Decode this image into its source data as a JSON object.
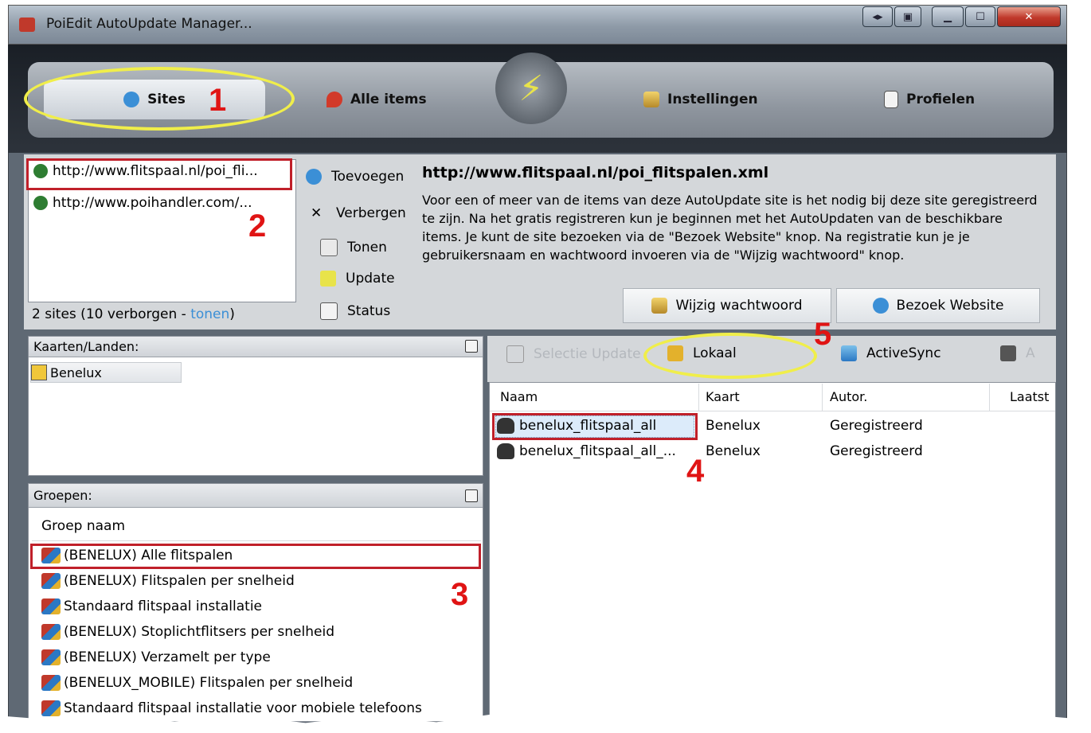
{
  "window": {
    "title": "PoiEdit AutoUpdate Manager..."
  },
  "nav": {
    "tabs": [
      {
        "label": "Sites"
      },
      {
        "label": "Alle items"
      },
      {
        "label": "Instellingen"
      },
      {
        "label": "Profielen"
      }
    ]
  },
  "annotations": {
    "n1": "1",
    "n2": "2",
    "n3": "3",
    "n4": "4",
    "n5": "5"
  },
  "sites": {
    "items": [
      "http://www.flitspaal.nl/poi_fli...",
      "http://www.poihandler.com/..."
    ],
    "status_prefix": "2 sites (10 verborgen - ",
    "status_link": "tonen",
    "status_suffix": ")"
  },
  "site_actions": [
    "Toevoegen",
    "Verbergen",
    "Tonen",
    "Update",
    "Status"
  ],
  "site_detail": {
    "url": "http://www.flitspaal.nl/poi_flitspalen.xml",
    "description": "Voor een of meer van de items van deze AutoUpdate site is het nodig bij deze site geregistreerd te zijn. Na het gratis registreren kun je beginnen met het AutoUpdaten van de beschikbare items. Je kunt de site bezoeken via de \"Bezoek Website\" knop. Na registratie kun je je gebruikersnaam en wachtwoord invoeren via de \"Wijzig wachtwoord\" knop.",
    "change_password": "Wijzig wachtwoord",
    "visit_website": "Bezoek Website"
  },
  "maps": {
    "header": "Kaarten/Landen:",
    "items": [
      "Benelux"
    ]
  },
  "groups": {
    "header": "Groepen:",
    "column": "Groep naam",
    "items": [
      "(BENELUX) Alle flitspalen",
      "(BENELUX) Flitspalen per snelheid",
      "Standaard flitspaal installatie",
      "(BENELUX) Stoplichtflitsers per snelheid",
      "(BENELUX) Verzamelt per type",
      "(BENELUX_MOBILE) Flitspalen per snelheid",
      "Standaard flitspaal installatie voor mobiele telefoons"
    ]
  },
  "items_toolbar": {
    "selection_update": "Selectie Update",
    "local": "Lokaal",
    "activesync": "ActiveSync",
    "cut": "A"
  },
  "items_table": {
    "columns": [
      "Naam",
      "Kaart",
      "Autor.",
      "Laatst"
    ],
    "rows": [
      {
        "name": "benelux_flitspaal_all",
        "map": "Benelux",
        "auth": "Geregistreerd"
      },
      {
        "name": "benelux_flitspaal_all_...",
        "map": "Benelux",
        "auth": "Geregistreerd"
      }
    ]
  }
}
